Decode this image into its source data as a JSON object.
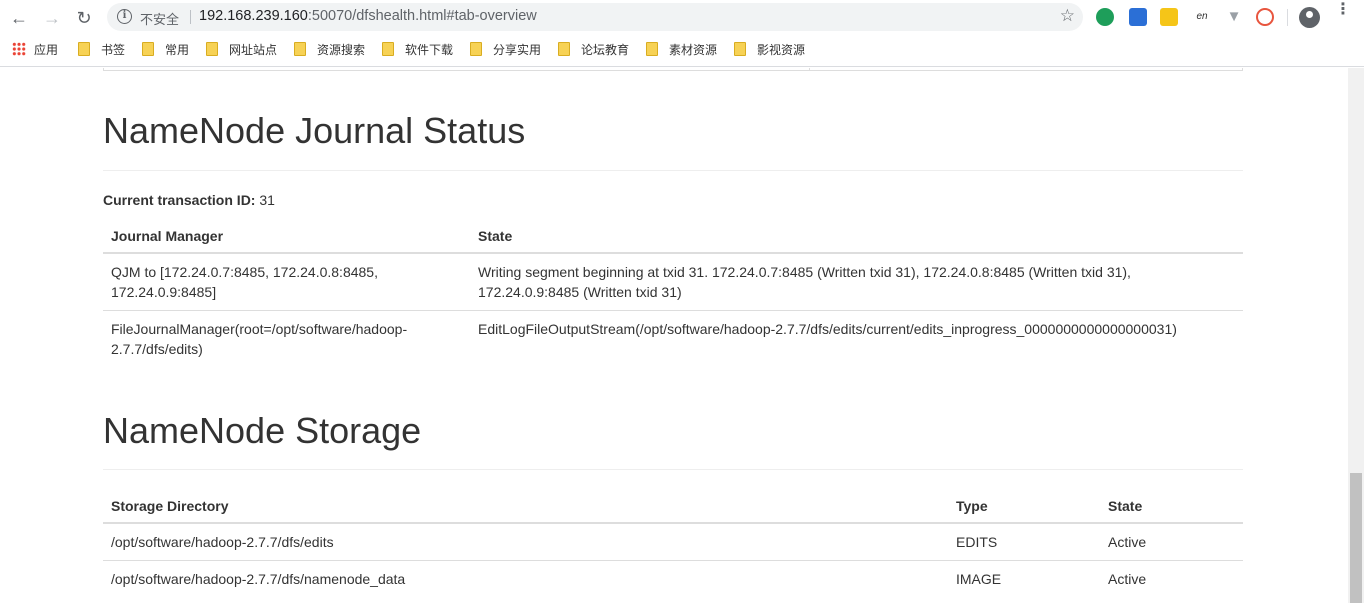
{
  "browser": {
    "insecure_label": "不安全",
    "url_host": "192.168.239.160",
    "url_rest": ":50070/dfshealth.html#tab-overview",
    "bookmarks": [
      "应用",
      "书签",
      "常用",
      "网址站点",
      "资源搜索",
      "软件下载",
      "分享实用",
      "论坛教育",
      "素材资源",
      "影视资源"
    ],
    "ext_en": "en"
  },
  "journal": {
    "title": "NameNode Journal Status",
    "tx_label": "Current transaction ID:",
    "tx_value": "31",
    "headers": [
      "Journal Manager",
      "State"
    ],
    "rows": [
      [
        "QJM to [172.24.0.7:8485, 172.24.0.8:8485, 172.24.0.9:8485]",
        "Writing segment beginning at txid 31. 172.24.0.7:8485 (Written txid 31), 172.24.0.8:8485 (Written txid 31), 172.24.0.9:8485 (Written txid 31)"
      ],
      [
        "FileJournalManager(root=/opt/software/hadoop-2.7.7/dfs/edits)",
        "EditLogFileOutputStream(/opt/software/hadoop-2.7.7/dfs/edits/current/edits_inprogress_0000000000000000031)"
      ]
    ]
  },
  "storage": {
    "title": "NameNode Storage",
    "headers": [
      "Storage Directory",
      "Type",
      "State"
    ],
    "rows": [
      [
        "/opt/software/hadoop-2.7.7/dfs/edits",
        "EDITS",
        "Active"
      ],
      [
        "/opt/software/hadoop-2.7.7/dfs/namenode_data",
        "IMAGE",
        "Active"
      ]
    ]
  }
}
